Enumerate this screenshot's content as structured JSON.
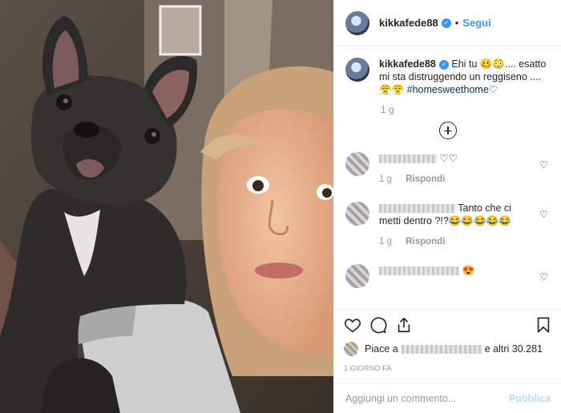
{
  "post": {
    "username": "kikkafede88",
    "follow_label": "Segui",
    "separator": "•",
    "caption_line1": "Ehi tu 🥴😳.... esatto",
    "caption_line2": "mi sta distruggendo un reggiseno ....",
    "caption_line3_emoji": "😤😤",
    "hashtag": "#homesweethome",
    "caption_heart": "♡",
    "time": "1 g"
  },
  "comments": [
    {
      "text": "♡♡",
      "time": "1 g",
      "reply_label": "Rispondi"
    },
    {
      "text": "Tanto che ci",
      "text2": "metti dentro ?!?😂😂😂😂😂",
      "time": "1 g",
      "reply_label": "Rispondi"
    },
    {
      "text": "😍"
    }
  ],
  "likes": {
    "prefix": "Piace a",
    "suffix": "e altri 30.281"
  },
  "timestamp": "1 GIORNO FA",
  "add_comment": {
    "placeholder": "Aggiungi un commento...",
    "publish_label": "Pubblica"
  },
  "icons": [
    "heart-icon",
    "comment-icon",
    "share-icon",
    "bookmark-icon",
    "plus-icon"
  ],
  "colors": {
    "accent": "#3897f0",
    "hashtag": "#003569",
    "publish_disabled": "#b2dffc"
  }
}
